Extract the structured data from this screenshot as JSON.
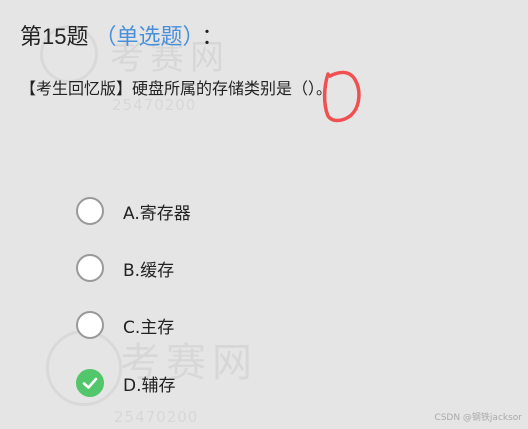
{
  "question": {
    "number_label": "第15题",
    "type_label": "（单选题）",
    "colon": "：",
    "text": "【考生回忆版】硬盘所属的存储类别是（）。"
  },
  "options": [
    {
      "label": "A.寄存器",
      "selected": false
    },
    {
      "label": "B.缓存",
      "selected": false
    },
    {
      "label": "C.主存",
      "selected": false
    },
    {
      "label": "D.辅存",
      "selected": true
    }
  ],
  "footer": {
    "credit": "CSDN @钢铁jacksor"
  },
  "colors": {
    "background": "#e5e5e5",
    "type_label": "#4a90d9",
    "selected": "#52c66a",
    "annotation": "#f05050"
  }
}
